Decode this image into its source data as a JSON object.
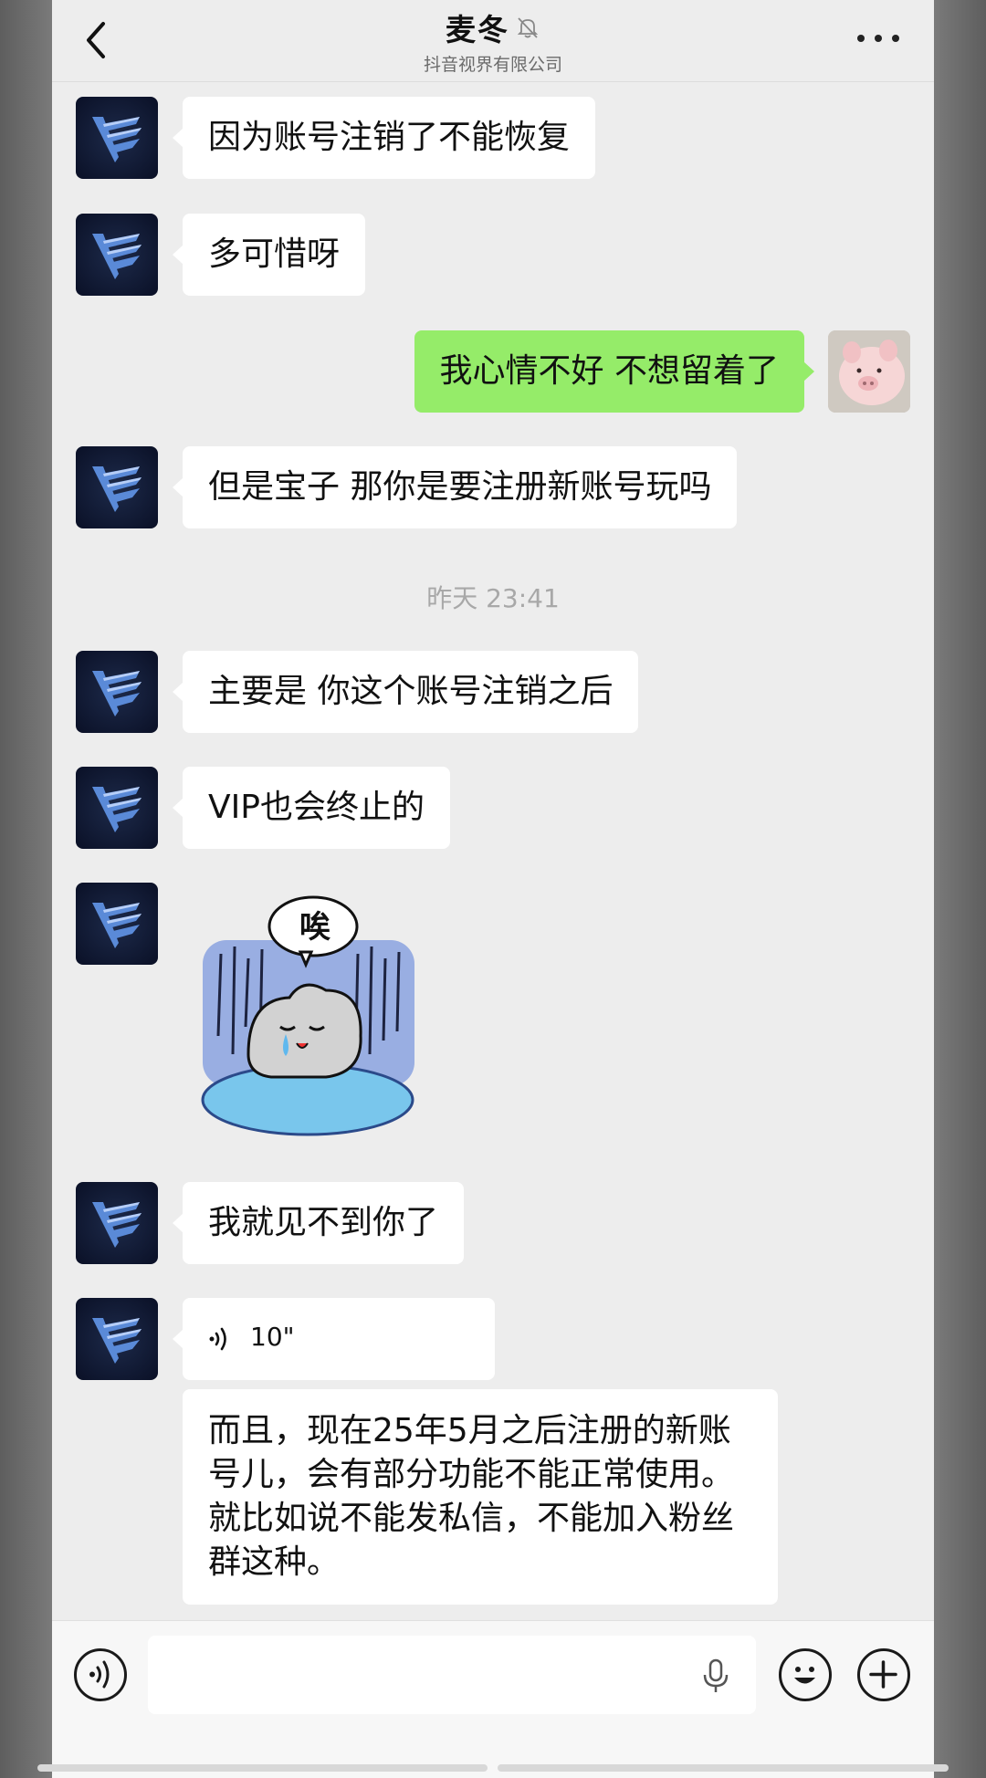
{
  "header": {
    "title": "麦冬",
    "subtitle": "抖音视界有限公司",
    "icons": [
      "back-arrow-icon",
      "bell-muted-icon",
      "more-dots-icon"
    ]
  },
  "messages": [
    {
      "sender": "contact",
      "type": "text",
      "text": "因为账号注销了不能恢复"
    },
    {
      "sender": "contact",
      "type": "text",
      "text": "多可惜呀"
    },
    {
      "sender": "me",
      "type": "text",
      "text": "我心情不好 不想留着了"
    },
    {
      "sender": "contact",
      "type": "text",
      "text": "但是宝子 那你是要注册新账号玩吗"
    },
    {
      "type": "timestamp",
      "text": "昨天 23:41"
    },
    {
      "sender": "contact",
      "type": "text",
      "text": "主要是 你这个账号注销之后"
    },
    {
      "sender": "contact",
      "type": "text",
      "text": "VIP也会终止的"
    },
    {
      "sender": "contact",
      "type": "sticker",
      "text": "唉"
    },
    {
      "sender": "contact",
      "type": "text",
      "text": "我就见不到你了"
    },
    {
      "sender": "contact",
      "type": "voice",
      "text": "10\""
    },
    {
      "sender": "contact",
      "type": "text",
      "text": "而且，现在25年5月之后注册的新账号儿，会有部分功能不能正常使用。就比如说不能发私信，不能加入粉丝群这种。"
    }
  ],
  "input_bar": {
    "value": "",
    "icons": [
      "voice-mode-icon",
      "microphone-icon",
      "emoji-icon",
      "plus-icon"
    ]
  },
  "colors": {
    "chat_bg": "#ededed",
    "my_bubble": "#95ec69",
    "contact_bubble": "#ffffff",
    "avatar_bg": "#0a1026"
  }
}
